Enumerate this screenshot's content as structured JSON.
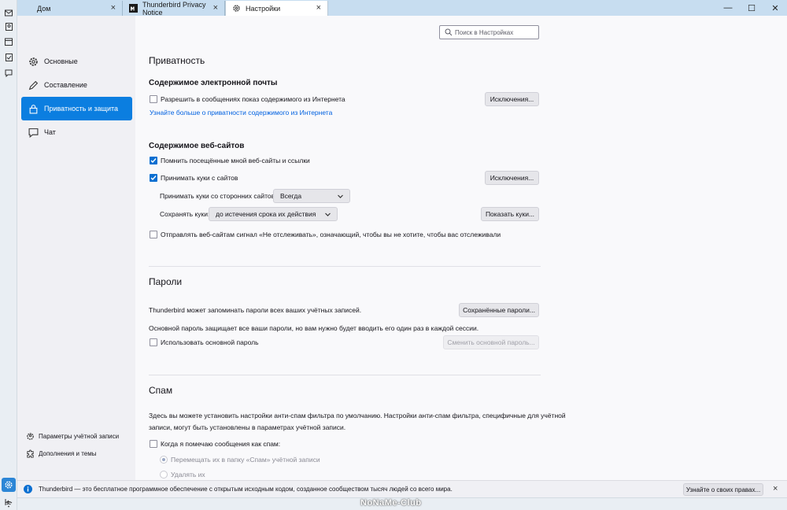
{
  "tabs": [
    {
      "label": "Дом",
      "icon": "home-icon",
      "close": "×"
    },
    {
      "label": "Thunderbird Privacy Notice",
      "icon": "page-m-icon",
      "close": "×"
    },
    {
      "label": "Настройки",
      "icon": "gear-icon",
      "close": "×"
    }
  ],
  "window_controls": {
    "minimize": "—",
    "maximize": "☐",
    "close": "✕"
  },
  "sidebar": {
    "categories": [
      {
        "label": "Основные",
        "icon": "gear-icon"
      },
      {
        "label": "Составление",
        "icon": "pen-icon"
      },
      {
        "label": "Приватность и защита",
        "icon": "lock-icon"
      },
      {
        "label": "Чат",
        "icon": "chat-icon"
      }
    ],
    "footer": [
      {
        "label": "Параметры учётной записи",
        "icon": "account-gear-icon"
      },
      {
        "label": "Дополнения и темы",
        "icon": "puzzle-icon"
      }
    ]
  },
  "search": {
    "placeholder": "Поиск в Настройках"
  },
  "privacy": {
    "title": "Приватность",
    "email_content": {
      "heading": "Содержимое электронной почты",
      "allow_remote_label": "Разрешить в сообщениях показ содержимого из Интернета",
      "exceptions_button": "Исключения...",
      "learn_more_link": "Узнайте больше о приватности содержимого из Интернета"
    },
    "web_content": {
      "heading": "Содержимое веб-сайтов",
      "remember_history_label": "Помнить посещённые мной веб-сайты и ссылки",
      "accept_cookies_label": "Принимать куки с сайтов",
      "exceptions_button": "Исключения...",
      "third_party_label": "Принимать куки со сторонних сайтов:",
      "third_party_value": "Всегда",
      "keep_label": "Сохранять куки:",
      "keep_value": "до истечения срока их действия",
      "show_cookies_button": "Показать куки...",
      "dnt_label": "Отправлять веб-сайтам сигнал «Не отслеживать», означающий, чтобы вы не хотите, чтобы вас отслеживали"
    }
  },
  "passwords": {
    "title": "Пароли",
    "description": "Thunderbird может запоминать пароли всех ваших учётных записей.",
    "saved_button": "Сохранённые пароли...",
    "primary_desc": "Основной пароль защищает все ваши пароли, но вам нужно будет вводить его один раз в каждой сессии.",
    "use_primary_label": "Использовать основной пароль",
    "change_primary_button": "Сменить основной пароль..."
  },
  "spam": {
    "title": "Спам",
    "description_line1": "Здесь вы можете установить настройки анти-спам фильтра по умолчанию. Настройки анти-спам фильтра, специфичные для учётной",
    "description_line2": "записи, могут быть установлены в параметрах учётной записи.",
    "when_marked_label": "Когда я помечаю сообщения как спам:",
    "move_option": "Перемещать их в папку «Спам» учётной записи",
    "delete_option": "Удалять их"
  },
  "notification": {
    "text": "Thunderbird — это бесплатное программное обеспечение с открытым исходным кодом, созданное сообществом тысяч людей со всего мира.",
    "button": "Узнайте о своих правах...",
    "close": "×"
  },
  "watermark": "NoNaMe-Club",
  "colors": {
    "accent": "#0b7ee0",
    "link": "#0061e0",
    "titlebar": "#c7ddf0"
  }
}
